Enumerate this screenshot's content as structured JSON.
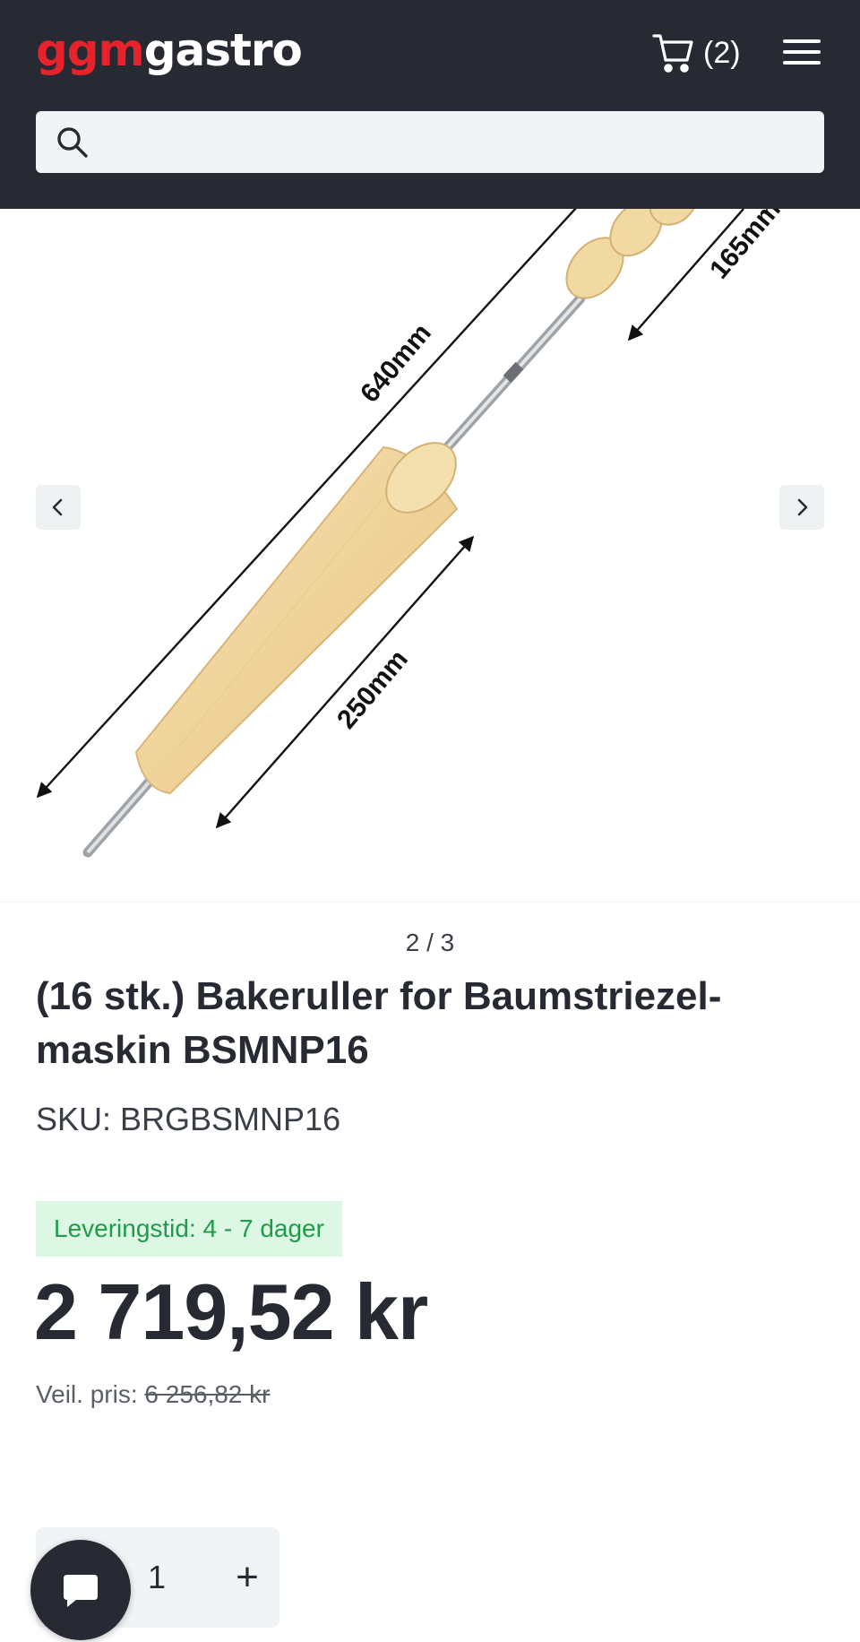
{
  "header": {
    "logo_part1": "ggm",
    "logo_part2": "gastro",
    "cart_count": "(2)"
  },
  "search": {
    "placeholder": ""
  },
  "gallery": {
    "labels": {
      "total_length": "640mm",
      "top_length": "165mm",
      "handle_length": "250mm"
    },
    "counter": "2 / 3"
  },
  "product": {
    "title": "(16 stk.) Bakeruller for Baumstriezel-maskin BSMNP16",
    "sku": "SKU: BRGBSMNP16",
    "delivery": "Leveringstid: 4 - 7 dager",
    "price": "2 719,52 kr",
    "rrp_label": "Veil. pris: ",
    "rrp_value": "6 256,82 kr"
  },
  "quantity": {
    "value": "1",
    "plus": "+"
  },
  "colors": {
    "header_bg": "#272a33",
    "logo_red": "#e6222a",
    "badge_bg": "#dcf8e4",
    "badge_text": "#1f9b4a",
    "wood": "#f1d9a2"
  },
  "icons": [
    "cart-icon",
    "menu-icon",
    "search-icon",
    "chevron-left-icon",
    "chevron-right-icon",
    "chat-icon"
  ]
}
